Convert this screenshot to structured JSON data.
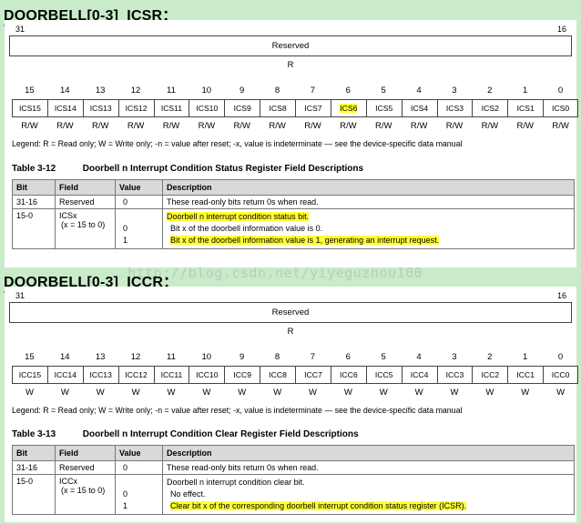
{
  "sections": [
    {
      "heading": "DOORBELL[0-3]_ICSR：",
      "bit_high": "31",
      "bit_low": "16",
      "reserved": "Reserved",
      "reserved_access": "R",
      "bit_numbers": [
        "15",
        "14",
        "13",
        "12",
        "11",
        "10",
        "9",
        "8",
        "7",
        "6",
        "5",
        "4",
        "3",
        "2",
        "1",
        "0"
      ],
      "fields": [
        "ICS15",
        "ICS14",
        "ICS13",
        "ICS12",
        "ICS11",
        "ICS10",
        "ICS9",
        "ICS8",
        "ICS7",
        "ICS6",
        "ICS5",
        "ICS4",
        "ICS3",
        "ICS2",
        "ICS1",
        "ICS0"
      ],
      "highlighted_field": "ICS6",
      "access": [
        "R/W",
        "R/W",
        "R/W",
        "R/W",
        "R/W",
        "R/W",
        "R/W",
        "R/W",
        "R/W",
        "R/W",
        "R/W",
        "R/W",
        "R/W",
        "R/W",
        "R/W",
        "R/W"
      ],
      "legend": "Legend: R = Read only; W = Write only; -n = value after reset; -x, value is indeterminate — see the device-specific data manual",
      "table_number": "Table 3-12",
      "table_title": "Doorbell n Interrupt Condition Status Register Field Descriptions",
      "columns": [
        "Bit",
        "Field",
        "Value",
        "Description"
      ],
      "row1": {
        "bit": "31-16",
        "field": "Reserved",
        "value": "0",
        "desc": "These read-only bits return 0s when read."
      },
      "row2": {
        "bit": "15-0",
        "field": "ICSx",
        "field_sub": "(x = 15 to 0)",
        "value_blank": "",
        "value0": "0",
        "value1": "1",
        "desc_main": "Doorbell n interrupt condition status bit.",
        "desc0": "Bit x of the doorbell information value is 0.",
        "desc1": "Bit x of the doorbell information value is 1, generating an interrupt request."
      }
    },
    {
      "heading": "DOORBELL[0-3]_ICCR：",
      "bit_high": "31",
      "bit_low": "16",
      "reserved": "Reserved",
      "reserved_access": "R",
      "bit_numbers": [
        "15",
        "14",
        "13",
        "12",
        "11",
        "10",
        "9",
        "8",
        "7",
        "6",
        "5",
        "4",
        "3",
        "2",
        "1",
        "0"
      ],
      "fields": [
        "ICC15",
        "ICC14",
        "ICC13",
        "ICC12",
        "ICC11",
        "ICC10",
        "ICC9",
        "ICC8",
        "ICC7",
        "ICC6",
        "ICC5",
        "ICC4",
        "ICC3",
        "ICC2",
        "ICC1",
        "ICC0"
      ],
      "highlighted_field": "",
      "access": [
        "W",
        "W",
        "W",
        "W",
        "W",
        "W",
        "W",
        "W",
        "W",
        "W",
        "W",
        "W",
        "W",
        "W",
        "W",
        "W"
      ],
      "legend": "Legend: R = Read only; W = Write only; -n = value after reset; -x, value is indeterminate — see the device-specific data manual",
      "table_number": "Table 3-13",
      "table_title": "Doorbell n Interrupt Condition Clear Register Field Descriptions",
      "columns": [
        "Bit",
        "Field",
        "Value",
        "Description"
      ],
      "row1": {
        "bit": "31-16",
        "field": "Reserved",
        "value": "0",
        "desc": "These read-only bits return 0s when read."
      },
      "row2": {
        "bit": "15-0",
        "field": "ICCx",
        "field_sub": "(x = 15 to 0)",
        "value_blank": "",
        "value0": "0",
        "value1": "1",
        "desc_main": "Doorbell n interrupt condition clear bit.",
        "desc0": "No effect.",
        "desc1": "Clear bit x of the corresponding doorbell interrupt condition status register (ICSR)."
      }
    }
  ],
  "watermark": "http://blog.csdn.net/yiyeguzhou100",
  "colors": {
    "background": "#c9ebc9",
    "highlight": "#ffff33",
    "table_header": "#d9d9d9"
  }
}
